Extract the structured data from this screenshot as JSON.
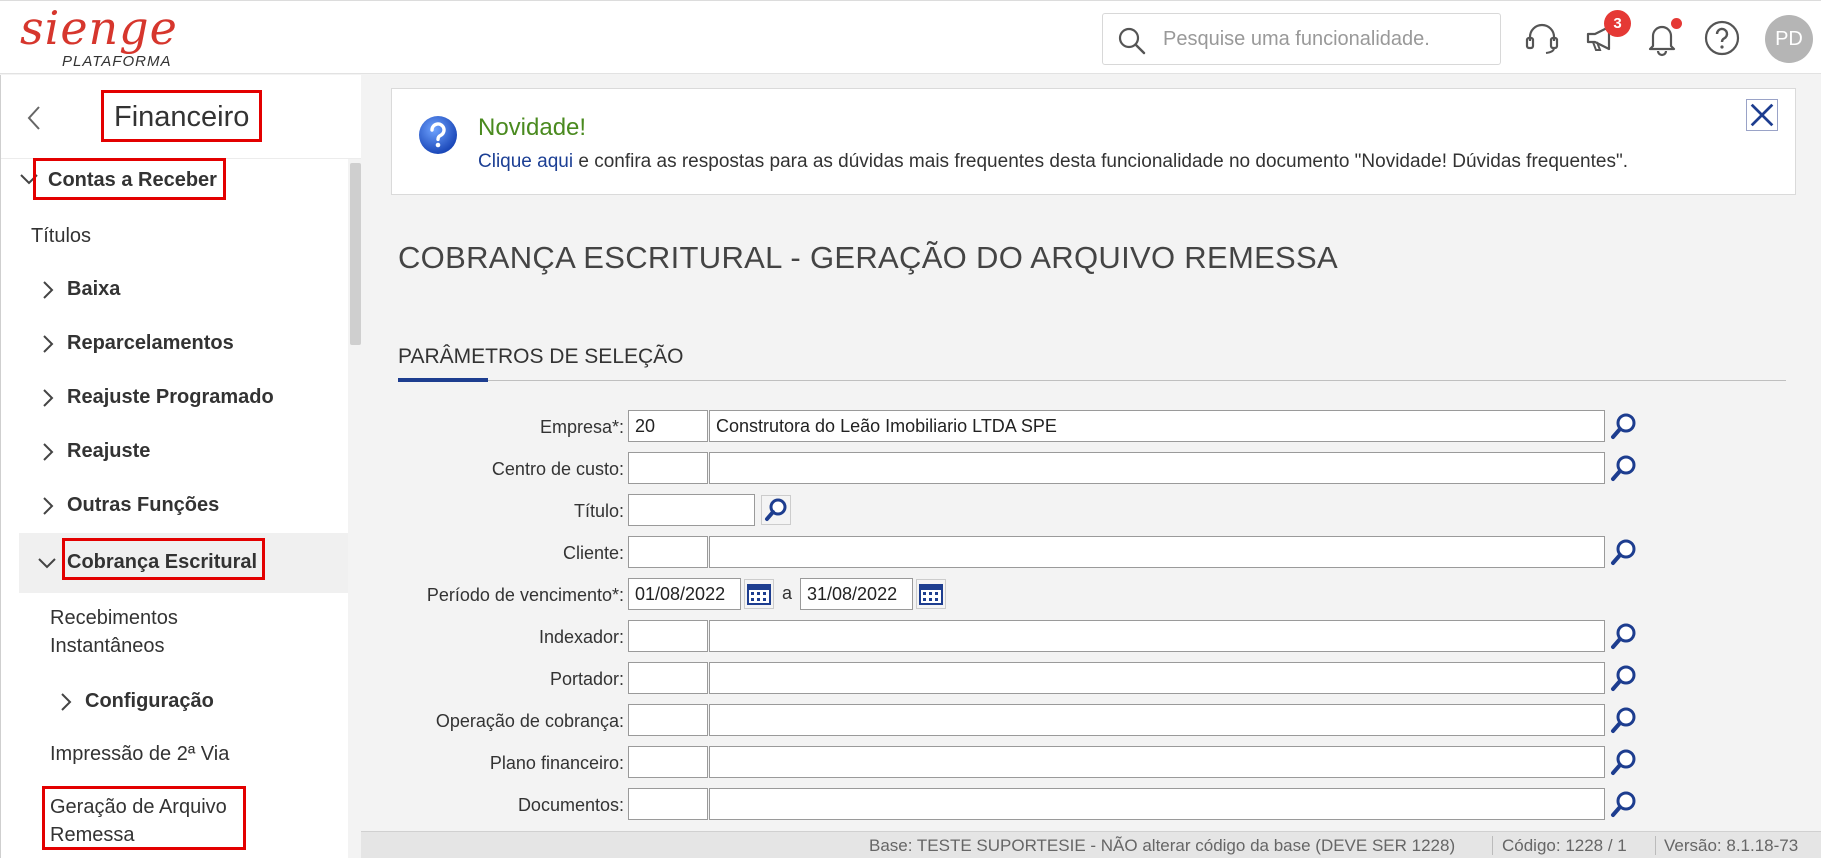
{
  "header": {
    "logo_main": "sienge",
    "logo_sub": "PLATAFORMA",
    "search_placeholder": "Pesquise uma funcionalidade.",
    "notifications_count": "3",
    "avatar_initials": "PD"
  },
  "sidebar": {
    "title": "Financeiro",
    "items": [
      {
        "label": "Contas a Receber"
      },
      {
        "label": "Títulos"
      },
      {
        "label": "Baixa"
      },
      {
        "label": "Reparcelamentos"
      },
      {
        "label": "Reajuste Programado"
      },
      {
        "label": "Reajuste"
      },
      {
        "label": "Outras Funções"
      },
      {
        "label": "Cobrança Escritural"
      },
      {
        "label": "Recebimentos"
      },
      {
        "label": "Instantâneos"
      },
      {
        "label": "Configuração"
      },
      {
        "label": "Impressão de 2ª Via"
      },
      {
        "label": "Geração de Arquivo"
      },
      {
        "label": "Remessa"
      }
    ]
  },
  "banner": {
    "title": "Novidade!",
    "link_text": "Clique aqui",
    "text": " e confira as respostas para as dúvidas mais frequentes desta funcionalidade no documento \"Novidade! Dúvidas frequentes\"."
  },
  "page": {
    "title": "COBRANÇA ESCRITURAL - GERAÇÃO DO ARQUIVO REMESSA",
    "section": "PARÂMETROS DE SELEÇÃO"
  },
  "form": {
    "empresa_label": "Empresa*:",
    "empresa_code": "20",
    "empresa_name": "Construtora do Leão Imobiliario LTDA SPE",
    "centro_label": "Centro de custo:",
    "titulo_label": "Título:",
    "cliente_label": "Cliente:",
    "periodo_label": "Período de vencimento*:",
    "periodo_from": "01/08/2022",
    "periodo_sep": "a",
    "periodo_to": "31/08/2022",
    "indexador_label": "Indexador:",
    "portador_label": "Portador:",
    "operacao_label": "Operação de cobrança:",
    "plano_label": "Plano financeiro:",
    "documentos_label": "Documentos:"
  },
  "status": {
    "base": "Base: TESTE SUPORTESIE - NÃO alterar código da base (DEVE SER 1228)",
    "codigo": "Código: 1228 / 1",
    "versao": "Versão: 8.1.18-73"
  },
  "colors": {
    "brand_red": "#d6362d",
    "highlight_red": "#e30000",
    "link_blue": "#1c3f94",
    "novidade_green": "#4a8a1f"
  }
}
